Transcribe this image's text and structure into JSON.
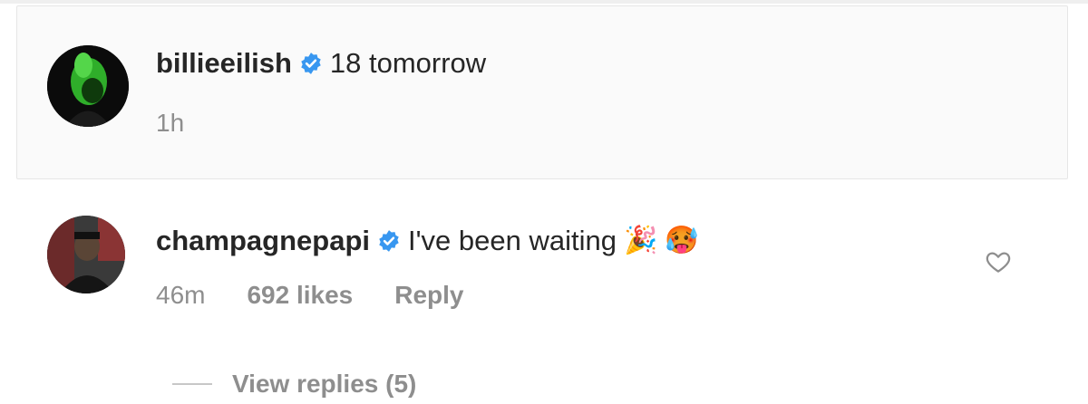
{
  "post_caption": {
    "username": "billieeilish",
    "verified_icon": "verified-badge-icon",
    "text": "18 tomorrow",
    "time": "1h"
  },
  "comment": {
    "username": "champagnepapi",
    "verified_icon": "verified-badge-icon",
    "text": "I've been waiting",
    "emojis": [
      "🎉",
      "🥵"
    ],
    "time": "46m",
    "likes": "692 likes",
    "reply_label": "Reply",
    "like_icon": "heart-outline-icon",
    "view_replies": "View replies (5)"
  },
  "colors": {
    "verified": "#3897f0",
    "secondary_text": "#8e8e8e",
    "primary_text": "#262626"
  }
}
